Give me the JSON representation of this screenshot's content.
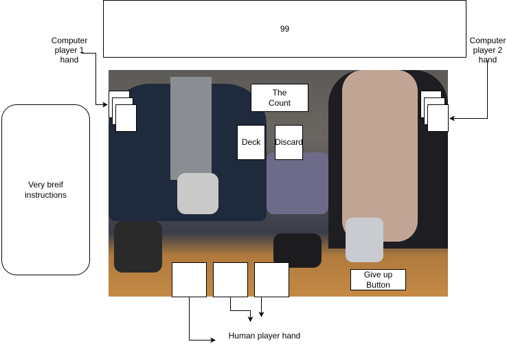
{
  "score_display": {
    "value": "99"
  },
  "labels": {
    "computer_player_1": "Computer player 1 hand",
    "computer_player_2": "Computer player 2 hand",
    "human_player": "Human player hand"
  },
  "instructions": {
    "text": "Very breif instructions"
  },
  "table": {
    "count_label": "The Count",
    "deck_label": "Deck",
    "discard_label": "Discard",
    "give_up_label": "Give up Button"
  }
}
